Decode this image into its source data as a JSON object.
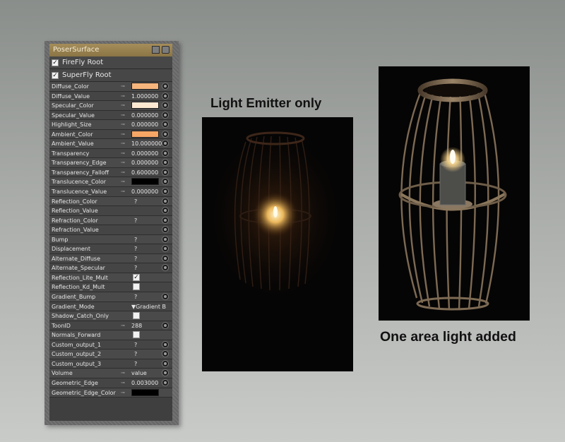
{
  "panel": {
    "title": "PoserSurface",
    "roots": [
      {
        "label": "FireFly Root",
        "checked": true
      },
      {
        "label": "SuperFly Root",
        "checked": true
      }
    ],
    "params": [
      {
        "label": "Diffuse_Color",
        "type": "color",
        "color": "#f7b57c",
        "key": true,
        "node": true
      },
      {
        "label": "Diffuse_Value",
        "type": "value",
        "value": "1.000000",
        "key": true,
        "node": true
      },
      {
        "label": "Specular_Color",
        "type": "color",
        "color": "#fde9d2",
        "key": true,
        "node": true
      },
      {
        "label": "Specular_Value",
        "type": "value",
        "value": "0.000000",
        "key": true,
        "node": true
      },
      {
        "label": "Highlight_Size",
        "type": "value",
        "value": "0.000000",
        "key": true,
        "node": true
      },
      {
        "label": "Ambient_Color",
        "type": "color",
        "color": "#f6a665",
        "key": true,
        "node": true
      },
      {
        "label": "Ambient_Value",
        "type": "value",
        "value": "10.000000",
        "key": true,
        "node": true
      },
      {
        "label": "Transparency",
        "type": "value",
        "value": "0.000000",
        "key": true,
        "node": true
      },
      {
        "label": "Transparency_Edge",
        "type": "value",
        "value": "0.000000",
        "key": true,
        "node": true
      },
      {
        "label": "Transparency_Falloff",
        "type": "value",
        "value": "0.600000",
        "key": true,
        "node": true
      },
      {
        "label": "Translucence_Color",
        "type": "color",
        "color": "#000000",
        "key": true,
        "node": true
      },
      {
        "label": "Translucence_Value",
        "type": "value",
        "value": "0.000000",
        "key": true,
        "node": true
      },
      {
        "label": "Reflection_Color",
        "type": "q",
        "value": "?",
        "key": false,
        "node": true
      },
      {
        "label": "Reflection_Value",
        "type": "none",
        "key": false,
        "node": true
      },
      {
        "label": "Refraction_Color",
        "type": "q",
        "value": "?",
        "key": false,
        "node": true
      },
      {
        "label": "Refraction_Value",
        "type": "none",
        "key": false,
        "node": true
      },
      {
        "label": "Bump",
        "type": "q",
        "value": "?",
        "key": false,
        "node": true
      },
      {
        "label": "Displacement",
        "type": "q",
        "value": "?",
        "key": false,
        "node": true
      },
      {
        "label": "Alternate_Diffuse",
        "type": "q",
        "value": "?",
        "key": false,
        "node": true
      },
      {
        "label": "Alternate_Specular",
        "type": "q",
        "value": "?",
        "key": false,
        "node": true
      },
      {
        "label": "Reflection_Lite_Mult",
        "type": "check",
        "checked": true,
        "key": false,
        "node": false
      },
      {
        "label": "Reflection_Kd_Mult",
        "type": "check",
        "checked": false,
        "key": false,
        "node": false
      },
      {
        "label": "Gradient_Bump",
        "type": "q",
        "value": "?",
        "key": false,
        "node": true
      },
      {
        "label": "Gradient_Mode",
        "type": "value",
        "value": "▼Gradient B",
        "key": false,
        "node": false
      },
      {
        "label": "Shadow_Catch_Only",
        "type": "check",
        "checked": false,
        "key": false,
        "node": false
      },
      {
        "label": "ToonID",
        "type": "value",
        "value": "288",
        "key": true,
        "node": true
      },
      {
        "label": "Normals_Forward",
        "type": "check",
        "checked": false,
        "key": false,
        "node": false
      },
      {
        "label": "Custom_output_1",
        "type": "q",
        "value": "?",
        "key": false,
        "node": true
      },
      {
        "label": "Custom_output_2",
        "type": "q",
        "value": "?",
        "key": false,
        "node": true
      },
      {
        "label": "Custom_output_3",
        "type": "q",
        "value": "?",
        "key": false,
        "node": true
      },
      {
        "label": "Volume",
        "type": "value",
        "value": "value",
        "key": true,
        "node": true
      },
      {
        "label": "Geometric_Edge",
        "type": "value",
        "value": "0.003000",
        "key": true,
        "node": true
      },
      {
        "label": "Geometric_Edge_Color",
        "type": "color",
        "color": "#000000",
        "key": true,
        "node": false
      }
    ]
  },
  "renders": {
    "emitter_caption": "Light Emitter only",
    "area_light_caption": "One area light added"
  },
  "colors": {
    "panel_title_bg": "#a58d5a",
    "candle_flame": "#ffd98a",
    "lantern_wood": "#6b5a45"
  },
  "icons": {
    "key": "key-icon",
    "node": "node-socket-icon",
    "check": "checkmark-icon"
  }
}
